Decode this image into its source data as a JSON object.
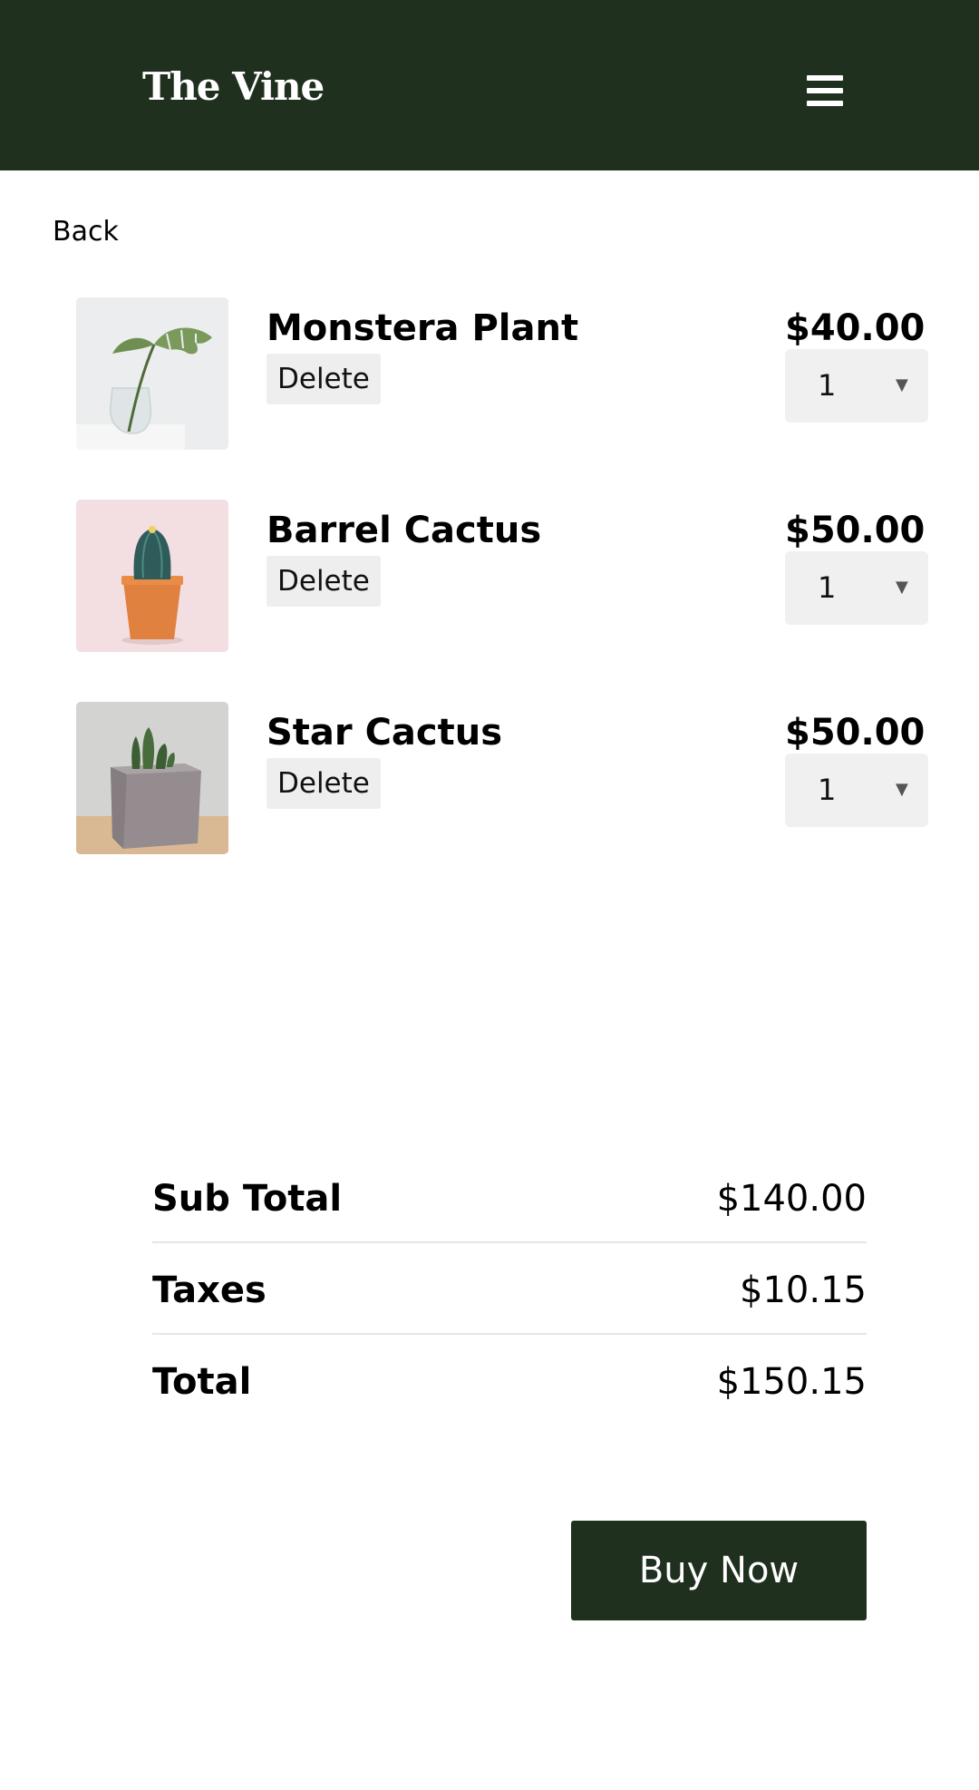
{
  "header": {
    "brand": "The Vine",
    "menu_icon": "hamburger-menu-icon"
  },
  "nav": {
    "back_label": "Back"
  },
  "cart": {
    "items": [
      {
        "name": "Monstera Plant",
        "delete_label": "Delete",
        "price": "$40.00",
        "quantity": "1",
        "image": "monstera-leaf-in-glass-vase"
      },
      {
        "name": "Barrel Cactus",
        "delete_label": "Delete",
        "price": "$50.00",
        "quantity": "1",
        "image": "cactus-in-orange-pot"
      },
      {
        "name": "Star Cactus",
        "delete_label": "Delete",
        "price": "$50.00",
        "quantity": "1",
        "image": "cactus-in-grey-square-pot"
      }
    ],
    "dropdown_icon": "caret-down-icon"
  },
  "summary": {
    "subtotal_label": "Sub Total",
    "subtotal_value": "$140.00",
    "taxes_label": "Taxes",
    "taxes_value": "$10.15",
    "total_label": "Total",
    "total_value": "$150.15"
  },
  "actions": {
    "buy_label": "Buy Now"
  },
  "colors": {
    "brand_dark_green": "#20301f",
    "control_background": "#f0f0f0"
  }
}
